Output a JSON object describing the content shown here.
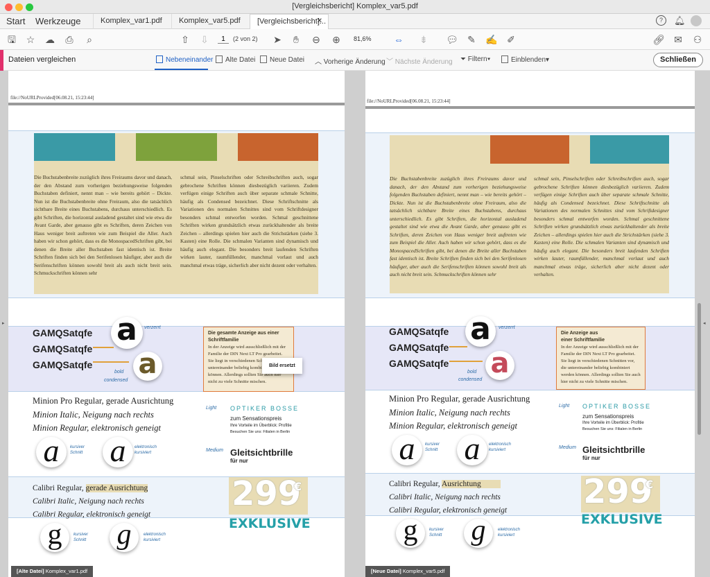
{
  "window": {
    "title": "[Vergleichsbericht] Komplex_var5.pdf",
    "colors": {
      "close": "#ff5f57",
      "minimize": "#febc2e",
      "zoom": "#28c840"
    }
  },
  "tabs": {
    "home": "Start",
    "tools": "Werkzeuge",
    "docs": [
      "Komplex_var1.pdf",
      "Komplex_var5.pdf",
      "[Vergleichsbericht]..."
    ]
  },
  "toolbar": {
    "page_number": "1",
    "page_total": "(2 von 2)",
    "zoom": "81,6%"
  },
  "compare_bar": {
    "title": "Dateien vergleichen",
    "side_by_side": "Nebeneinander",
    "old_file": "Alte Datei",
    "new_file": "Neue Datei",
    "prev_change": "Vorherige Änderung",
    "next_change": "Nächste Änderung",
    "filter": "Filtern",
    "show": "Einblenden",
    "close": "Schließen"
  },
  "pages": {
    "header_text": "file://NoURLProvided[06.08.21, 15:23:44]",
    "left_footer_tag": "[Alte Datei]",
    "left_footer_file": "Komplex_var1.pdf",
    "right_footer_tag": "[Neue Datei]",
    "right_footer_file": "Komplex_var5.pdf"
  },
  "color_blocks": {
    "left": [
      "#3a9aa6",
      "#7ea23c",
      "#c8642e"
    ],
    "right": [
      "#e8dcb4",
      "#c8642e",
      "#3a9aa6"
    ]
  },
  "left_text": {
    "col1": "Die Buchstabenbreite zuzüglich ihres Freiraums davor und danach, der den Abstand zum vorherigen beziehungsweise folgenden Buchstaben definiert, nennt man – wie bereits gehört – Dickte. Nun ist die Buchstabenbreite ohne Freiraum, also die tatsächlich sichtbare Breite eines Buchstabens, durchaus unterschiedlich. Es gibt Schriften, die horizontal ausladend gestaltet sind wie etwa die Avant Garde, aber genauso gibt es Schriften, deren Zeichen von Haus weniger breit auftreten wie zum Beispiel die Aller. Auch haben wir schon gehört, dass es die MonospacedSchriften gibt, bei denen die Breite aller Buchstaben fast identisch ist.   Breite Schriften finden sich bei den Serifenlosen häufiger, aber auch die Serifenschriften können sowohl breit als auch nicht breit sein. Schmuckschriften können sehr",
    "col2": "schmal sein, Pinselschriften oder Schreibschriften auch, sogar gebrochene Schriften können diesbezüglich variieren.   Zudem verfügen einige Schriften auch über separate schmale Schnitte, häufig als Condensed bezeichnet. Diese Schriftschnitte als Variationen des normalen Schnittes sind vom Schriftdesigner besonders schmal entworfen worden. Schmal geschnittene Schriften wirken grundsätzlich etwas zurückhaltender als breite Zeichen – allerdings spielen hier auch die Strichstärken (siehe 3. Kasten) eine Rolle. Die schmalen Varianten sind dynamisch und häufig auch elegant. Die besonders breit laufenden Schriften wirken lauter, raumfüllender, manchmal vorlaut und auch manchmal etwas träge, sicherlich aber nicht dezent oder verhalten."
  },
  "right_text": {
    "col1": "Die Buchstabenbreite zuzüglich ihres Freiraums davor und danach, der den Abstand zum vorherigen beziehungsweise folgenden Buchstaben definiert, nennt man – wie bereits gehört – Dickte. Nun ist die Buchstabenbreite ohne Freiraum, also die tatsächlich sichtbare Breite eines Buchstabens, durchaus unterschiedlich. Es gibt Schriften, die horizontal ausladend gestaltet sind wie etwa die Avant Garde, aber genauso gibt es Schriften, deren Zeichen von Haus weniger breit auftreten wie zum Beispiel die Aller. Auch haben wir schon gehört, dass es die MonospacedSchriften gibt, bei denen die Breite aller Buchstaben fast identisch ist.   Breite Schriften finden sich bei den Serifenlosen häufiger, aber auch die Serifenschriften können sowohl breit als auch nicht breit sein. Schmuckschriften können sehr",
    "col2": "schmal sein, Pinselschriften oder Schreibschriften auch, sogar gebrochene Schriften können diesbezüglich variieren.   Zudem verfügen einige Schriften auch über separate schmale Schnitte, häufig als Condensed bezeichnet. Diese Schriftschnitte als Variationen des normalen Schnittes sind vom Schriftdesigner besonders schmal entworfen worden. Schmal geschnittene Schriften wirken grundsätzlich etwas zurückhaltender als breite Zeichen – allerdings spielen hier auch die Strichstärken (siehe 3. Kasten) eine Rolle. Die schmalen Varianten sind dynamisch und häufig auch elegant. Die besonders breit laufenden Schriften wirken lauter, raumfüllender, manchmal vorlaut und auch manchmal etwas träge, sicherlich aber nicht dezent oder verhalten."
  },
  "font_demo": {
    "gam": "GAMQSatqfe",
    "glyph_a": "a",
    "label_verzerrt": "verzerrt",
    "label_bold1": "bold",
    "label_bold2": "condensed",
    "box_left_title": "Die gesamte Anzeige aus einer Schriftfamilie",
    "box_left_body": "In der Anzeige wird ausschließlich mit der Familie der DIN Next LT Pro gearbeitet. Sie liegt in verschiedenen Schnitten vor, die untereinander beliebig kombiniert werden können. Allerdings sollten Sie auch hier nicht zu viele Schnitte mischen.",
    "box_right_title1": "Die Anzeige aus",
    "box_right_title2": "einer Schriftfamilie",
    "box_right_body": "In der Anzeige wird ausschließlich mit der Familie der DIN Next LT Pro gearbeitet. Sie liegt in verschiedenen Schnitten vor, die untereinander beliebig kombiniert werden können. Allerdings sollten Sie auch hier nicht zu viele Schnitte mischen.",
    "tooltip": "Bild ersetzt"
  },
  "minion": {
    "line1": "Minion Pro Regular, gerade Ausrichtung",
    "line2": "Minion Italic, Neigung nach rechts",
    "line3": "Minion Regular, elektronisch geneigt",
    "note1a": "kursiver",
    "note1b": "Schnitt",
    "note2a": "elektronisch",
    "note2b": "kursiviert"
  },
  "ad": {
    "light": "Light",
    "brand": "OPTIKER BOSSE",
    "sub1": "zum Sensationspreis",
    "sub2": "Ihre Vorteile im Überblick: Profitie",
    "sub3": "Besuchen Sie uns: Filialen in Berlin",
    "medium": "Medium",
    "product": "Gleitsichtbrille",
    "fornur": "für nur",
    "price": "299",
    "currency": "€",
    "exklusive": "EXKLUSIVE"
  },
  "calibri": {
    "left_prefix": "Calibri Regular, ",
    "left_highlight": "gerade Ausrichtung",
    "right_prefix": "Calibri Regular, ",
    "right_highlight": "Ausrichtung",
    "line2": "Calibri Italic, Neigung nach rechts",
    "line3": "Calibri Regular, elektronisch geneigt",
    "glyph_g": "g"
  }
}
